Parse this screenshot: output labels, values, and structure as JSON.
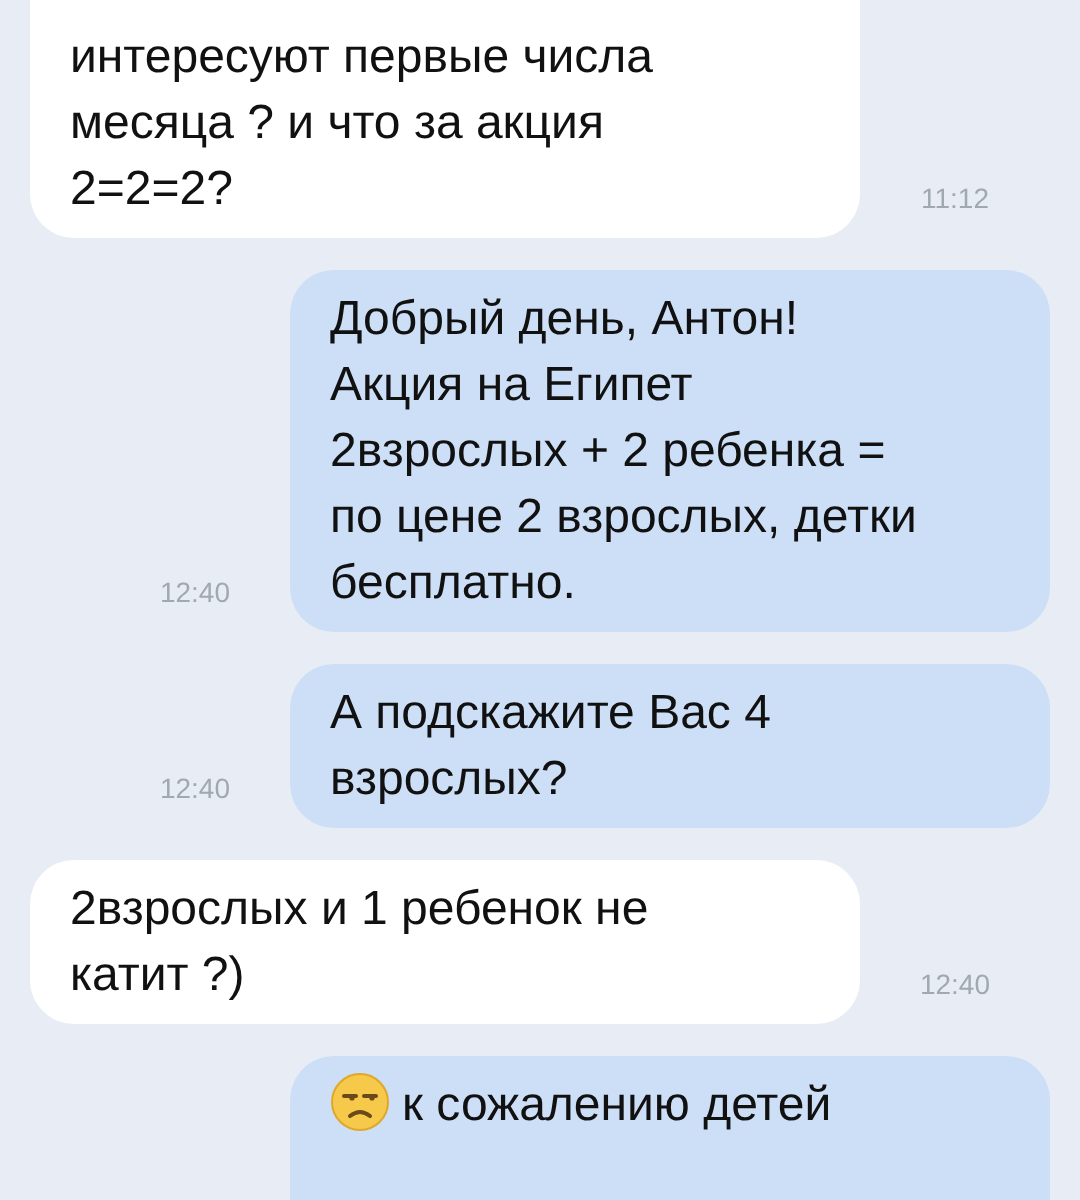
{
  "messages": [
    {
      "kind": "incoming",
      "text": "интересуют первые числа\nмесяца ? и что за акция\n2=2=2?",
      "time": "11:12"
    },
    {
      "kind": "outgoing",
      "text": "Добрый день, Антон!\nАкция на Египет\n2взрослых + 2 ребенка =\nпо цене 2 взрослых, детки\nбесплатно.",
      "time": "12:40"
    },
    {
      "kind": "outgoing",
      "text": "А подскажите Вас 4\nвзрослых?",
      "time": "12:40"
    },
    {
      "kind": "incoming",
      "text": "2взрослых и 1 ребенок не\nкатит ?)",
      "time": "12:40"
    },
    {
      "kind": "outgoing",
      "text": "к сожалению детей",
      "emoji_before": true
    }
  ]
}
